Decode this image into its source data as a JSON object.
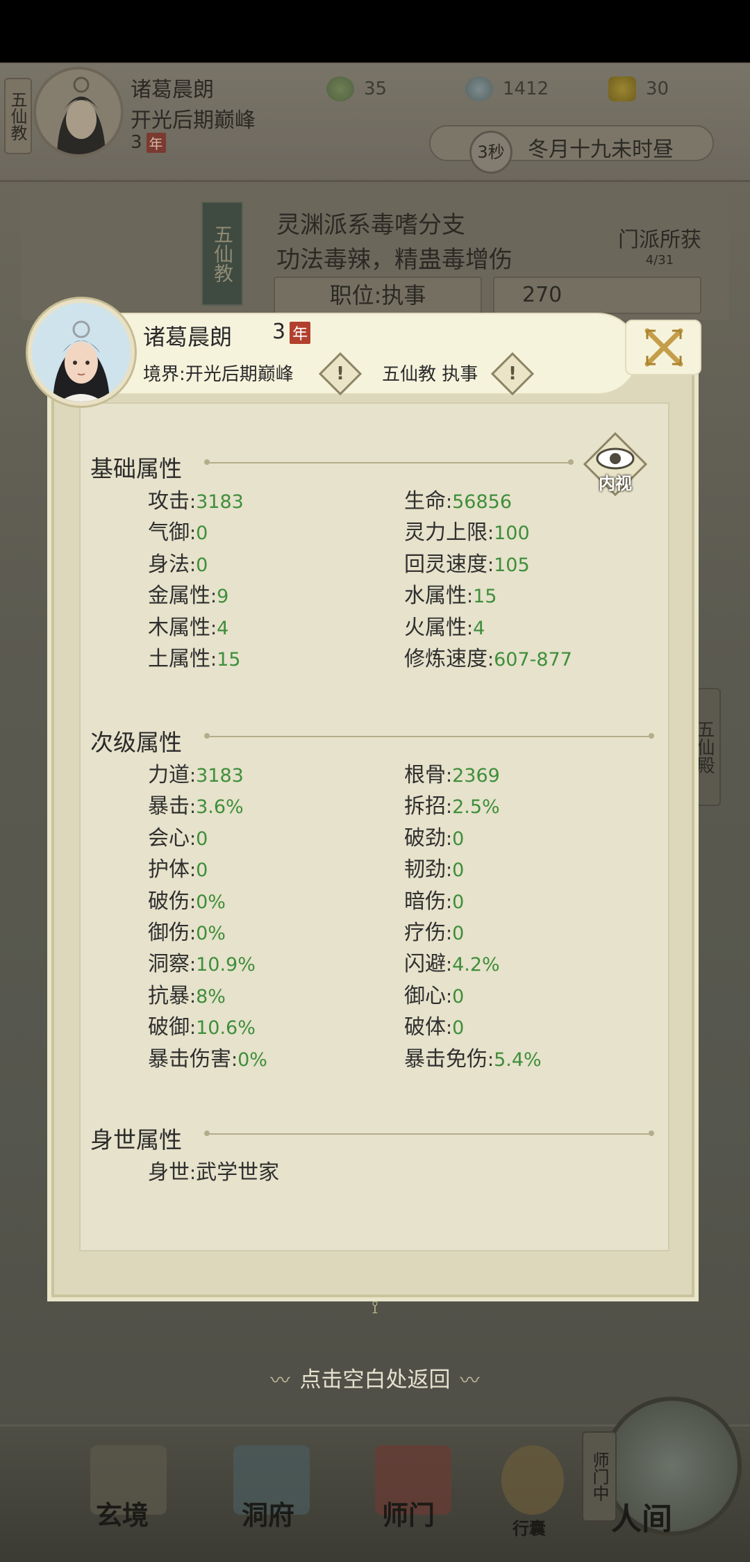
{
  "topbar": {
    "sect_tag": "五仙教",
    "name": "诸葛晨朗",
    "realm": "开光后期巅峰",
    "age": "3",
    "age_unit": "年",
    "resources": [
      {
        "icon": "jade-ring-icon",
        "value": "35",
        "color": "#5f7a49"
      },
      {
        "icon": "coin-icon",
        "value": "1412",
        "color": "#6e7b7e"
      },
      {
        "icon": "gold-ingot-icon",
        "value": "30",
        "color": "#8a7421"
      }
    ],
    "timer": "3秒",
    "date": "冬月十九未时昼"
  },
  "banner": {
    "flag": "五仙教",
    "line1": "灵渊派系毒嗜分支",
    "line2": "功法毒辣，精蛊毒增伤",
    "position": "职位:执事",
    "contribution": "270",
    "gain_label": "门派所获",
    "gain_count": "4/31"
  },
  "side_tab": "五仙殿",
  "card": {
    "name": "诸葛晨朗",
    "age": "3",
    "age_unit": "年",
    "realm_label": "境界:开光后期巅峰",
    "sect_label": "五仙教 执事",
    "inner_view": "内视",
    "basic": {
      "title": "基础属性",
      "left": [
        {
          "k": "攻击",
          "v": "3183"
        },
        {
          "k": "气御",
          "v": "0"
        },
        {
          "k": "身法",
          "v": "0"
        },
        {
          "k": "金属性",
          "v": "9"
        },
        {
          "k": "木属性",
          "v": "4"
        },
        {
          "k": "土属性",
          "v": "15"
        }
      ],
      "right": [
        {
          "k": "生命",
          "v": "56856"
        },
        {
          "k": "灵力上限",
          "v": "100"
        },
        {
          "k": "回灵速度",
          "v": "105"
        },
        {
          "k": "水属性",
          "v": "15"
        },
        {
          "k": "火属性",
          "v": "4"
        },
        {
          "k": "修炼速度",
          "v": "607-877"
        }
      ]
    },
    "secondary": {
      "title": "次级属性",
      "left": [
        {
          "k": "力道",
          "v": "3183"
        },
        {
          "k": "暴击",
          "v": "3.6%"
        },
        {
          "k": "会心",
          "v": "0"
        },
        {
          "k": "护体",
          "v": "0"
        },
        {
          "k": "破伤",
          "v": "0%"
        },
        {
          "k": "御伤",
          "v": "0%"
        },
        {
          "k": "洞察",
          "v": "10.9%"
        },
        {
          "k": "抗暴",
          "v": "8%"
        },
        {
          "k": "破御",
          "v": "10.6%"
        },
        {
          "k": "暴击伤害",
          "v": "0%"
        }
      ],
      "right": [
        {
          "k": "根骨",
          "v": "2369"
        },
        {
          "k": "拆招",
          "v": "2.5%"
        },
        {
          "k": "破劲",
          "v": "0"
        },
        {
          "k": "韧劲",
          "v": "0"
        },
        {
          "k": "暗伤",
          "v": "0"
        },
        {
          "k": "疗伤",
          "v": "0"
        },
        {
          "k": "闪避",
          "v": "4.2%"
        },
        {
          "k": "御心",
          "v": "0"
        },
        {
          "k": "破体",
          "v": "0"
        },
        {
          "k": "暴击免伤",
          "v": "5.4%"
        }
      ]
    },
    "background": {
      "title": "身世属性",
      "left": [
        {
          "k": "身世",
          "v": "武学世家"
        }
      ]
    }
  },
  "hint": "点击空白处返回",
  "nav": {
    "items": [
      "玄境",
      "洞府",
      "师门",
      "行囊",
      "人间"
    ],
    "mentor_tag": "师门中"
  },
  "colors": {
    "value_green": "#3f8e3b",
    "age_badge": "#b2402f",
    "card_bg": "#e6e2cb"
  }
}
